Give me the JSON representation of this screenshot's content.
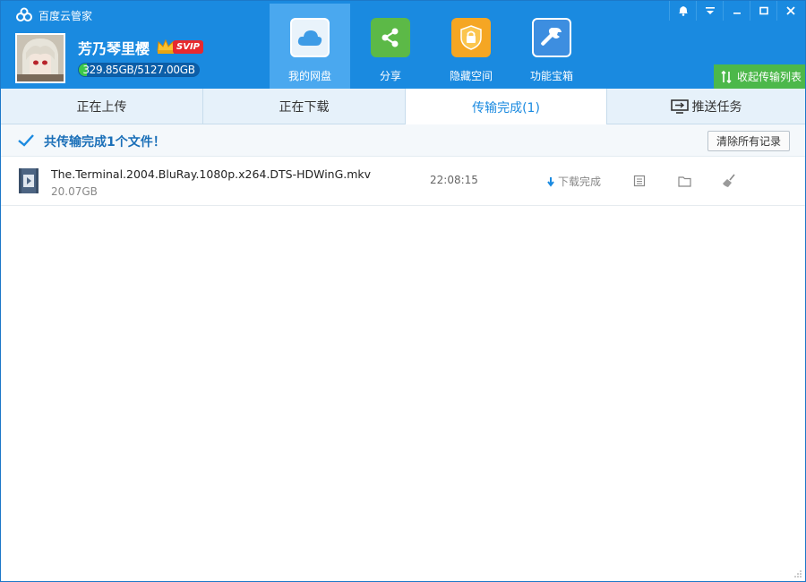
{
  "app": {
    "title": "百度云管家"
  },
  "user": {
    "name": "芳乃琴里樱",
    "vip_label": "SVIP",
    "quota_text": "329.85GB/5127.00GB",
    "quota_used_fraction": 0.064
  },
  "nav": [
    {
      "label": "我的网盘",
      "icon": "cloud-icon",
      "active": true
    },
    {
      "label": "分享",
      "icon": "share-icon",
      "active": false
    },
    {
      "label": "隐藏空间",
      "icon": "lock-icon",
      "active": false
    },
    {
      "label": "功能宝箱",
      "icon": "wrench-icon",
      "active": false
    }
  ],
  "collapse_label": "收起传输列表",
  "tabs": [
    {
      "label": "正在上传",
      "active": false
    },
    {
      "label": "正在下载",
      "active": false
    },
    {
      "label": "传输完成(1)",
      "active": true
    },
    {
      "label": "推送任务",
      "active": false
    }
  ],
  "summary": {
    "text": "共传输完成1个文件！",
    "clear_label": "清除所有记录"
  },
  "files": [
    {
      "name": "The.Terminal.2004.BluRay.1080p.x264.DTS-HDWinG.mkv",
      "size": "20.07GB",
      "time": "22:08:15",
      "status": "下载完成"
    }
  ],
  "colors": {
    "header": "#1a8ae0",
    "nav_active": "#4aa8ef",
    "collapse_button": "#4cb84a",
    "tab_bar": "#e6f1fa",
    "summary_text": "#1a6fb8"
  }
}
